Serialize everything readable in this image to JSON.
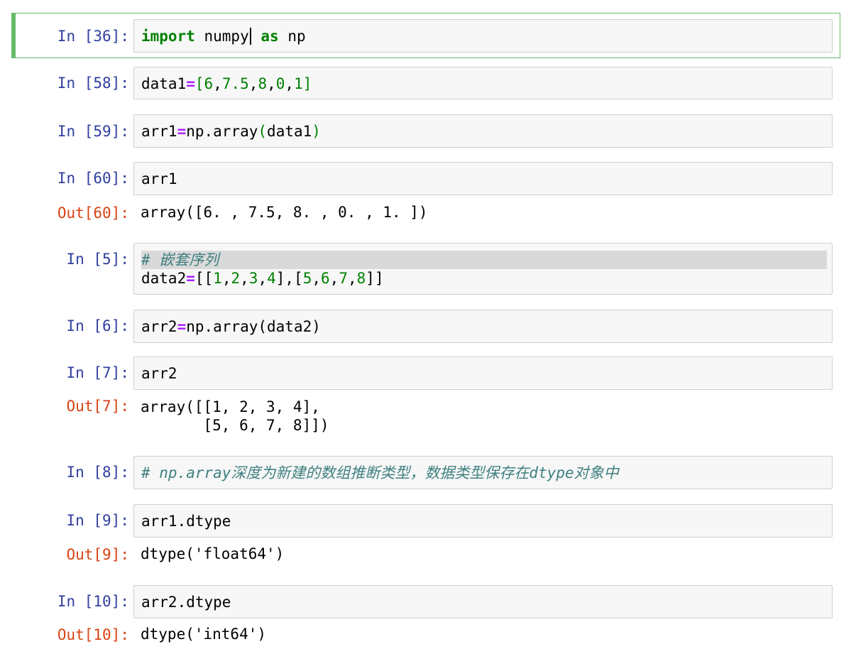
{
  "cells": [
    {
      "id": "c36",
      "in_prompt": "In [36]:",
      "code": {
        "import_kw": "import",
        "module": " numpy",
        "as_kw": "as",
        "alias": " np"
      }
    },
    {
      "id": "c58",
      "in_prompt": "In [58]:",
      "code": {
        "lhs": "data1",
        "op": "=",
        "open": "[",
        "items": [
          "6",
          "7.5",
          "8",
          "0",
          "1"
        ],
        "close": "]"
      }
    },
    {
      "id": "c59",
      "in_prompt": "In [59]:",
      "code": {
        "lhs": "arr1",
        "op": "=",
        "call": "np.array",
        "open": "(",
        "arg": "data1",
        "close": ")"
      }
    },
    {
      "id": "c60",
      "in_prompt": "In [60]:",
      "code": {
        "text": "arr1"
      },
      "out_prompt": "Out[60]:",
      "output": "array([6. , 7.5, 8. , 0. , 1. ])"
    },
    {
      "id": "c5",
      "in_prompt": "In [5]:",
      "code": {
        "comment": "# 嵌套序列",
        "lhs": "data2",
        "op": "=",
        "open": "[[",
        "row1": [
          "1",
          "2",
          "3",
          "4"
        ],
        "mid": "],[",
        "row2": [
          "5",
          "6",
          "7",
          "8"
        ],
        "close": "]]"
      }
    },
    {
      "id": "c6",
      "in_prompt": "In [6]:",
      "code": {
        "lhs": "arr2",
        "op": "=",
        "rhs": "np.array(data2)"
      }
    },
    {
      "id": "c7",
      "in_prompt": "In [7]:",
      "code": {
        "text": "arr2"
      },
      "out_prompt": "Out[7]:",
      "output": "array([[1, 2, 3, 4],\n       [5, 6, 7, 8]])"
    },
    {
      "id": "c8",
      "in_prompt": "In [8]:",
      "code": {
        "comment": "# np.array深度为新建的数组推断类型，数据类型保存在dtype对象中"
      }
    },
    {
      "id": "c9",
      "in_prompt": "In [9]:",
      "code": {
        "text": "arr1.dtype"
      },
      "out_prompt": "Out[9]:",
      "output": "dtype('float64')"
    },
    {
      "id": "c10",
      "in_prompt": "In [10]:",
      "code": {
        "text": "arr2.dtype"
      },
      "out_prompt": "Out[10]:",
      "output": "dtype('int64')"
    }
  ]
}
